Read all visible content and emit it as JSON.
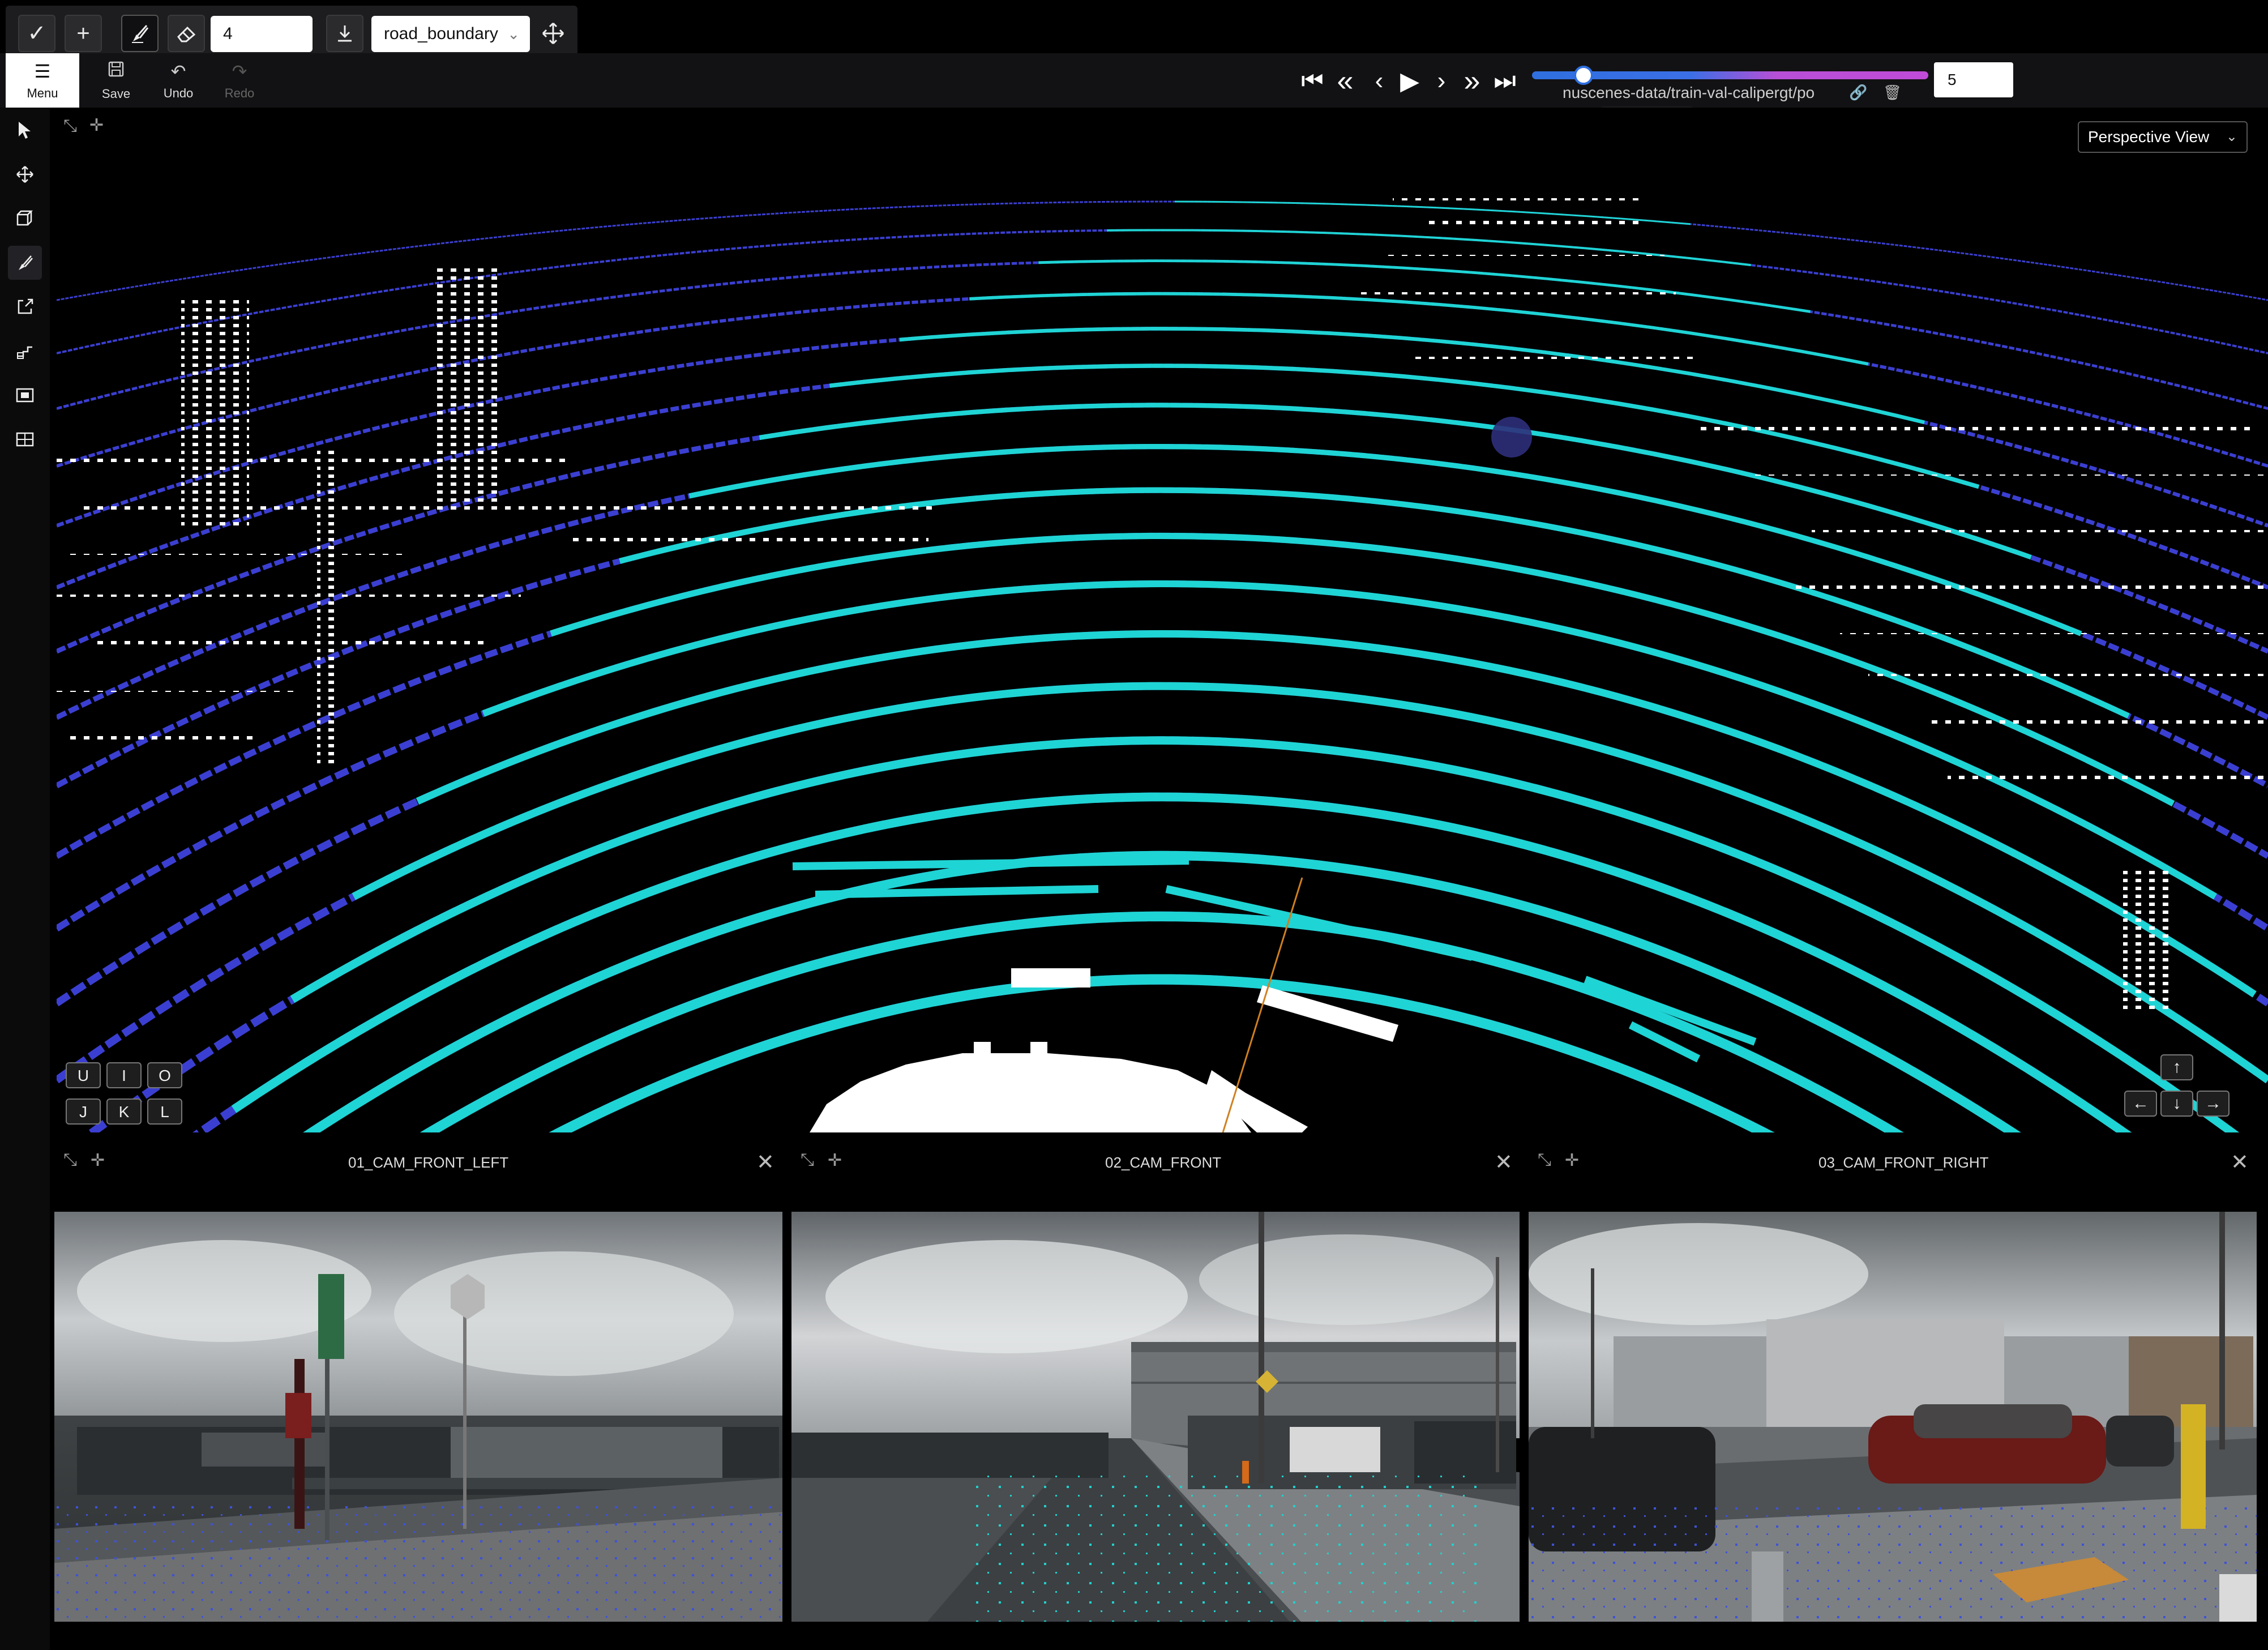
{
  "toolbar": {
    "confirm_icon": "check-icon",
    "add_icon": "plus-icon",
    "brush_icon": "brush-icon",
    "eraser_icon": "eraser-icon",
    "size_value": "4",
    "download_icon": "download-icon",
    "label_class": "road_boundary",
    "move_icon": "move-icon"
  },
  "secondary": {
    "menu_label": "Menu",
    "save_label": "Save",
    "undo_label": "Undo",
    "redo_label": "Redo"
  },
  "playback": {
    "frame_value": "5",
    "path_text": "nuscenes-data/train-val-calipergt/po"
  },
  "viewport": {
    "view_mode": "Perspective View",
    "keys_top": [
      "U",
      "I",
      "O"
    ],
    "keys_bottom": [
      "J",
      "K",
      "L"
    ],
    "colors": {
      "ground": "#1fd4d4",
      "nonground": "#3b3fd1",
      "object": "#ffffff",
      "heading_line": "#d08020"
    }
  },
  "cameras": [
    {
      "title": "01_CAM_FRONT_LEFT"
    },
    {
      "title": "02_CAM_FRONT"
    },
    {
      "title": "03_CAM_FRONT_RIGHT"
    }
  ]
}
